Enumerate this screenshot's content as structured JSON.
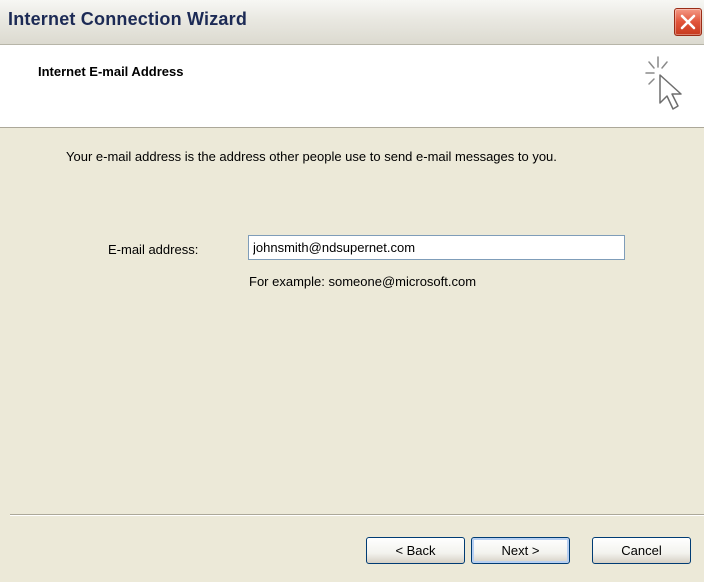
{
  "window": {
    "title": "Internet Connection Wizard"
  },
  "header": {
    "title": "Internet E-mail Address",
    "icon": "wizard-cursor-icon"
  },
  "body": {
    "description": "Your e-mail address is the address other people use to send e-mail messages to you.",
    "email_label": "E-mail address:",
    "email_value": "johnsmith@ndsupernet.com",
    "example": "For example: someone@microsoft.com"
  },
  "buttons": {
    "back": "< Back",
    "next": "Next >",
    "cancel": "Cancel"
  },
  "colors": {
    "title_text": "#1c2a55",
    "close_button": "#e1543a",
    "dialog_background": "#ece9d8"
  }
}
